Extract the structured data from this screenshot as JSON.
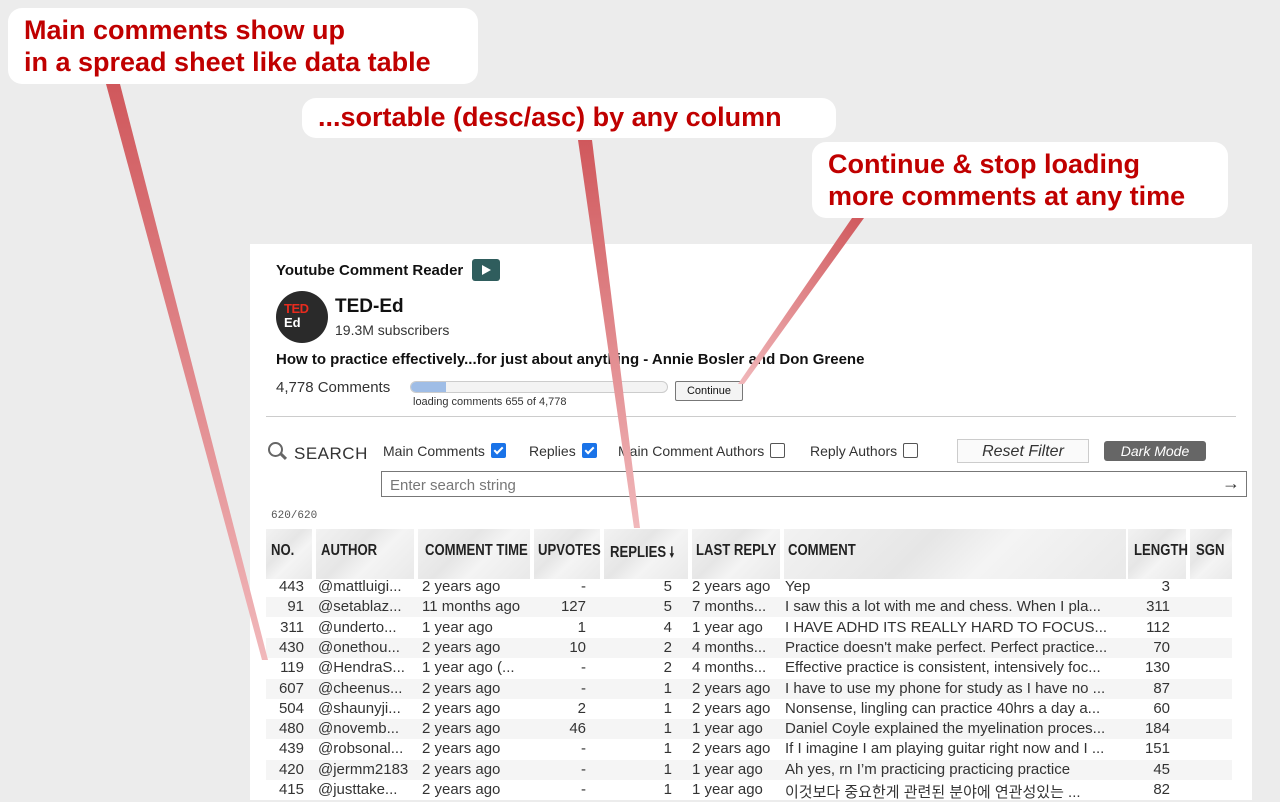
{
  "callouts": {
    "main_line1": "Main comments show up",
    "main_line2": "in a spread sheet like data table",
    "sortable": "...sortable (desc/asc) by any column",
    "continue_line1": "Continue & stop loading",
    "continue_line2": "more comments at any time"
  },
  "app": {
    "title": "Youtube Comment Reader",
    "icon": "youtube-play-icon"
  },
  "channel": {
    "avatar_line1": "TED",
    "avatar_line2": "Ed",
    "name": "TED-Ed",
    "subscribers": "19.3M subscribers"
  },
  "video": {
    "title": "How to practice effectively...for just about anything - Annie Bosler and Don Greene"
  },
  "loading": {
    "comment_count": "4,778 Comments",
    "progress_fraction": 0.137,
    "progress_text": "loading comments 655 of 4,778",
    "continue_label": "Continue"
  },
  "filters": {
    "search_label": "SEARCH",
    "main_comments": {
      "label": "Main Comments",
      "checked": true
    },
    "replies": {
      "label": "Replies",
      "checked": true
    },
    "main_authors": {
      "label": "Main Comment Authors",
      "checked": false
    },
    "reply_authors": {
      "label": "Reply Authors",
      "checked": false
    },
    "reset_label": "Reset Filter",
    "dark_mode_label": "Dark Mode",
    "search_placeholder": "Enter search string",
    "shown_count": "620/620"
  },
  "table": {
    "headers": [
      "NO.",
      "AUTHOR",
      "COMMENT TIME",
      "UPVOTES",
      "REPLIES",
      "LAST REPLY",
      "COMMENT",
      "LENGTH",
      "SGN"
    ],
    "sorted_column": "REPLIES",
    "sort_direction": "desc",
    "rows": [
      {
        "no": "443",
        "author": "@mattluigi...",
        "time": "2 years ago",
        "upvotes": "-",
        "replies": "5",
        "last_reply": "2 years ago",
        "comment": "Yep",
        "length": "3"
      },
      {
        "no": "91",
        "author": "@setablaz...",
        "time": "11 months ago",
        "upvotes": "127",
        "replies": "5",
        "last_reply": "7 months...",
        "comment": "I saw this a lot with me and chess. When I pla...",
        "length": "311"
      },
      {
        "no": "311",
        "author": "@underto...",
        "time": "1 year ago",
        "upvotes": "1",
        "replies": "4",
        "last_reply": "1 year ago",
        "comment": "I HAVE ADHD ITS REALLY HARD TO FOCUS...",
        "length": "112"
      },
      {
        "no": "430",
        "author": "@onethou...",
        "time": "2 years ago",
        "upvotes": "10",
        "replies": "2",
        "last_reply": "4 months...",
        "comment": "Practice doesn't make perfect. Perfect practice...",
        "length": "70"
      },
      {
        "no": "119",
        "author": "@HendraS...",
        "time": "1 year ago (...",
        "upvotes": "-",
        "replies": "2",
        "last_reply": "4 months...",
        "comment": "Effective practice is consistent, intensively foc...",
        "length": "130"
      },
      {
        "no": "607",
        "author": "@cheenus...",
        "time": "2 years ago",
        "upvotes": "-",
        "replies": "1",
        "last_reply": "2 years ago",
        "comment": "I have to use my phone for study as I have no ...",
        "length": "87"
      },
      {
        "no": "504",
        "author": "@shaunyji...",
        "time": "2 years ago",
        "upvotes": "2",
        "replies": "1",
        "last_reply": "2 years ago",
        "comment": "Nonsense, lingling can practice 40hrs a day a...",
        "length": "60"
      },
      {
        "no": "480",
        "author": "@novemb...",
        "time": "2 years ago",
        "upvotes": "46",
        "replies": "1",
        "last_reply": "1 year ago",
        "comment": "Daniel Coyle explained the myelination proces...",
        "length": "184"
      },
      {
        "no": "439",
        "author": "@robsonal...",
        "time": "2 years ago",
        "upvotes": "-",
        "replies": "1",
        "last_reply": "2 years ago",
        "comment": "If I imagine I am playing guitar right now and I ...",
        "length": "151"
      },
      {
        "no": "420",
        "author": "@jermm2183",
        "time": "2 years ago",
        "upvotes": "-",
        "replies": "1",
        "last_reply": "1 year ago",
        "comment": "Ah yes, rn I’m practicing practicing practice",
        "length": "45"
      },
      {
        "no": "415",
        "author": "@justtake...",
        "time": "2 years ago",
        "upvotes": "-",
        "replies": "1",
        "last_reply": "1 year ago",
        "comment": "이것보다 중요한게 관련된 분야에 연관성있는 ...",
        "length": "82"
      }
    ]
  },
  "colors": {
    "callout_text": "#c00000",
    "callout_line": "#d8565a",
    "progress_fill": "#9fbde6",
    "checkbox_on": "#1a73e8",
    "youtube_icon": "#2f5d5d"
  }
}
